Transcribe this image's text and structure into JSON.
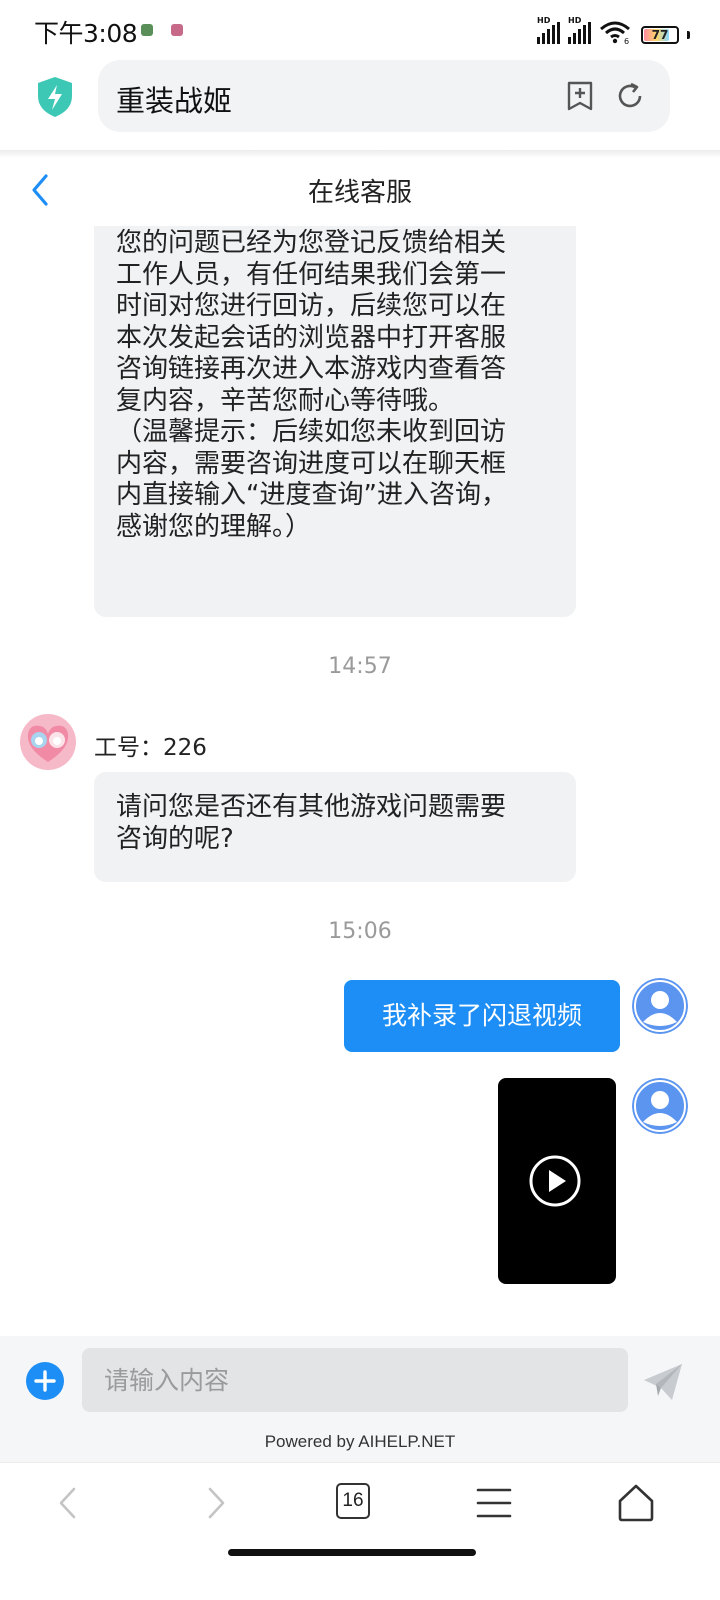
{
  "status_bar": {
    "time": "下午3:08",
    "signal_1_label": "HD",
    "signal_2_label": "HD",
    "wifi_label": "6",
    "battery": "77"
  },
  "browser": {
    "address_text": "重装战姬"
  },
  "chat": {
    "title": "在线客服",
    "agent_message_1_lines": [
      "您的问题已经为您登记反馈给相关",
      "工作人员，有任何结果我们会第一",
      "时间对您进行回访，后续您可以在",
      "本次发起会话的浏览器中打开客服",
      "咨询链接再次进入本游戏内查看答",
      "复内容，辛苦您耐心等待哦。",
      "（温馨提示：后续如您未收到回访",
      "内容，需要咨询进度可以在聊天框",
      "内直接输入“进度查询”进入咨询，",
      "感谢您的理解。）"
    ],
    "time_1": "14:57",
    "agent_name": "工号：226",
    "agent_message_2_lines": [
      "请问您是否还有其他游戏问题需要",
      "咨询的呢?"
    ],
    "time_2": "15:06",
    "user_message_1": "我补录了闪退视频"
  },
  "input": {
    "placeholder": "请输入内容",
    "powered_by": "Powered by AIHELP.NET"
  },
  "bottom_nav": {
    "tab_count": "16"
  },
  "colors": {
    "accent": "#1d8ef5",
    "shield": "#3cc8b4",
    "agent_bubble": "#f1f2f4"
  },
  "icons": {
    "shield": "shield-lightning-icon",
    "bookmark": "bookmark-add-icon",
    "refresh": "refresh-icon",
    "back": "chevron-left-icon",
    "add": "plus-circle-icon",
    "send": "paper-plane-icon",
    "play": "play-icon"
  }
}
